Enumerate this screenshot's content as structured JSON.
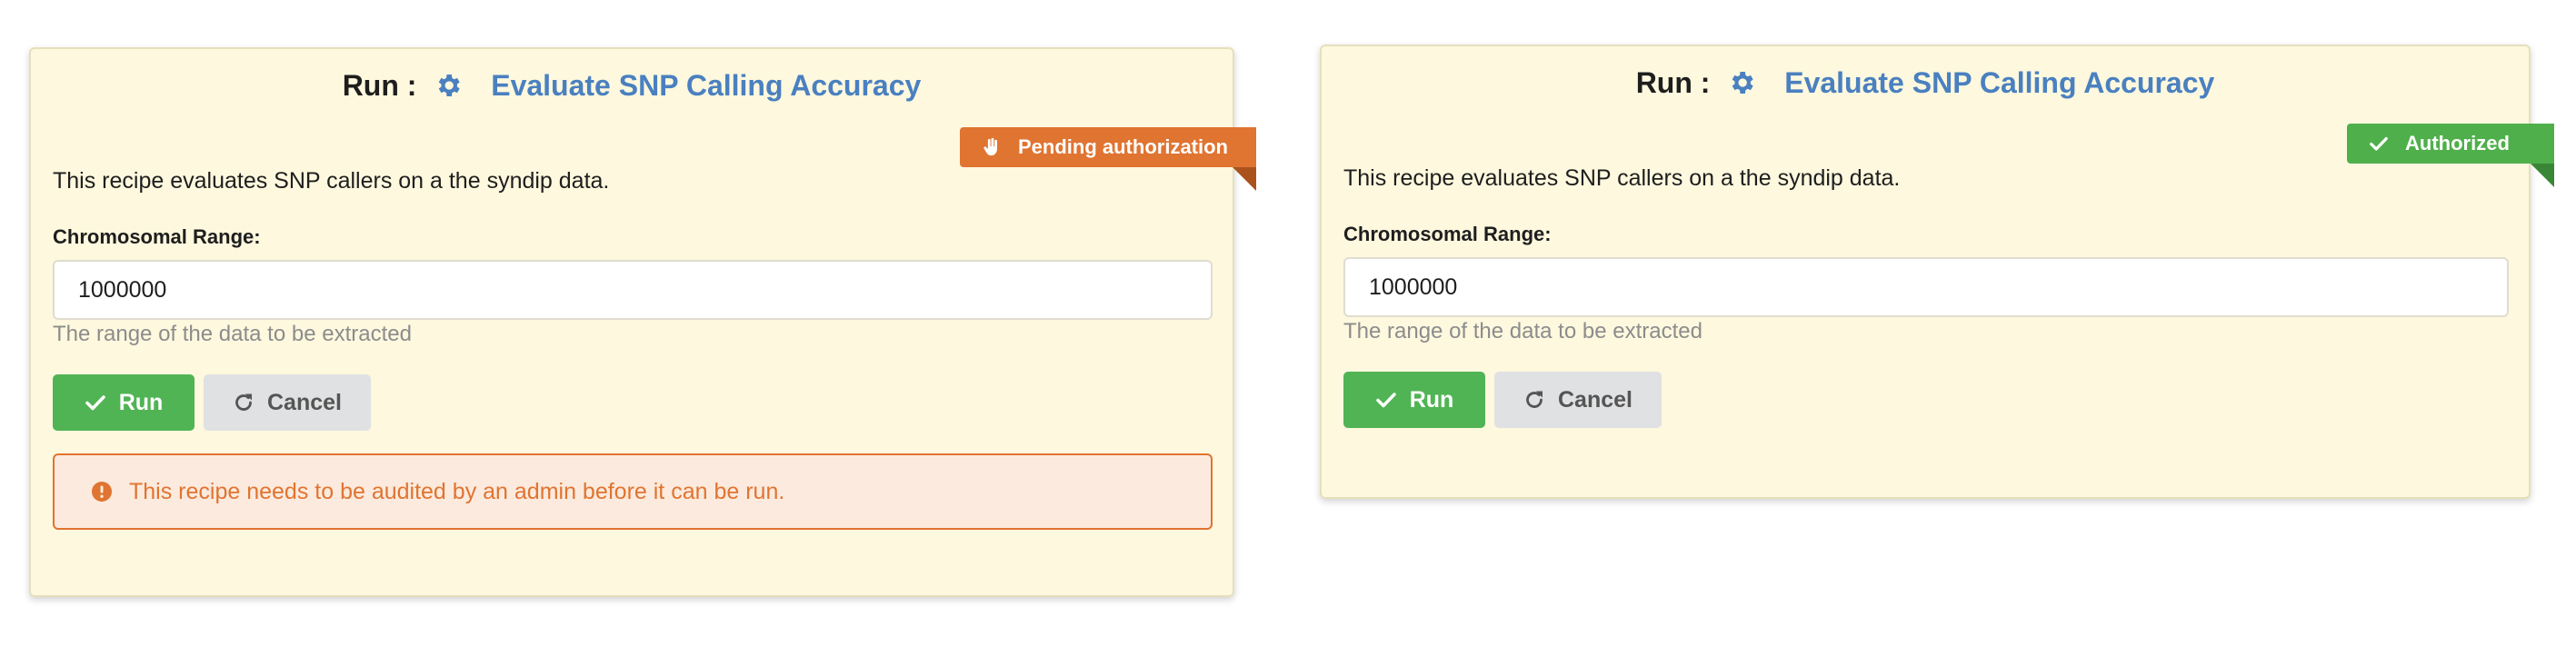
{
  "cards": [
    {
      "title_prefix": "Run :",
      "recipe_name": "Evaluate SNP Calling Accuracy",
      "badge": {
        "label": "Pending authorization",
        "icon": "hand-icon",
        "color": "#e07431"
      },
      "description": "This recipe evaluates SNP callers on a the syndip data.",
      "field": {
        "label": "Chromosomal Range:",
        "value": "1000000",
        "help": "The range of the data to be extracted"
      },
      "run_label": "Run",
      "cancel_label": "Cancel",
      "alert": {
        "text": "This recipe needs to be audited by an admin before it can be run.",
        "icon": "exclamation-circle-icon",
        "color": "#e07431"
      }
    },
    {
      "title_prefix": "Run :",
      "recipe_name": "Evaluate SNP Calling Accuracy",
      "badge": {
        "label": "Authorized",
        "icon": "check-icon",
        "color": "#4fb04b"
      },
      "description": "This recipe evaluates SNP callers on a the syndip data.",
      "field": {
        "label": "Chromosomal Range:",
        "value": "1000000",
        "help": "The range of the data to be extracted"
      },
      "run_label": "Run",
      "cancel_label": "Cancel"
    }
  ],
  "colors": {
    "card_background": "#fdf8de",
    "recipe_link": "#4a80c0",
    "run_button": "#50b454",
    "cancel_button": "#e0e1e2"
  }
}
